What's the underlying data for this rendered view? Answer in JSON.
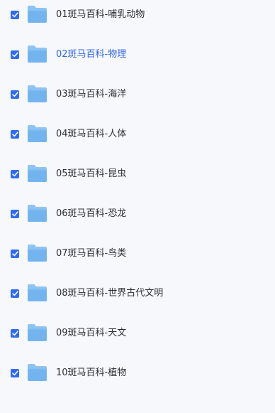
{
  "files": [
    {
      "name": "01斑马百科-哺乳动物",
      "checked": true,
      "active": false
    },
    {
      "name": "02斑马百科-物理",
      "checked": true,
      "active": true
    },
    {
      "name": "03斑马百科-海洋",
      "checked": true,
      "active": false
    },
    {
      "name": "04斑马百科-人体",
      "checked": true,
      "active": false
    },
    {
      "name": "05斑马百科-昆虫",
      "checked": true,
      "active": false
    },
    {
      "name": "06斑马百科-恐龙",
      "checked": true,
      "active": false
    },
    {
      "name": "07斑马百科-鸟类",
      "checked": true,
      "active": false
    },
    {
      "name": "08斑马百科-世界古代文明",
      "checked": true,
      "active": false
    },
    {
      "name": "09斑马百科-天文",
      "checked": true,
      "active": false
    },
    {
      "name": "10斑马百科-植物",
      "checked": true,
      "active": false
    }
  ],
  "icons": {
    "checkbox": "checkbox-checked-icon",
    "folder": "folder-icon"
  },
  "colors": {
    "background": "#f7f8fc",
    "checkbox": "#2f6bf0",
    "text": "#2c2e33",
    "active_text": "#2f66e6",
    "folder_front": "#74b4ee",
    "folder_back": "#8fc4f2"
  }
}
